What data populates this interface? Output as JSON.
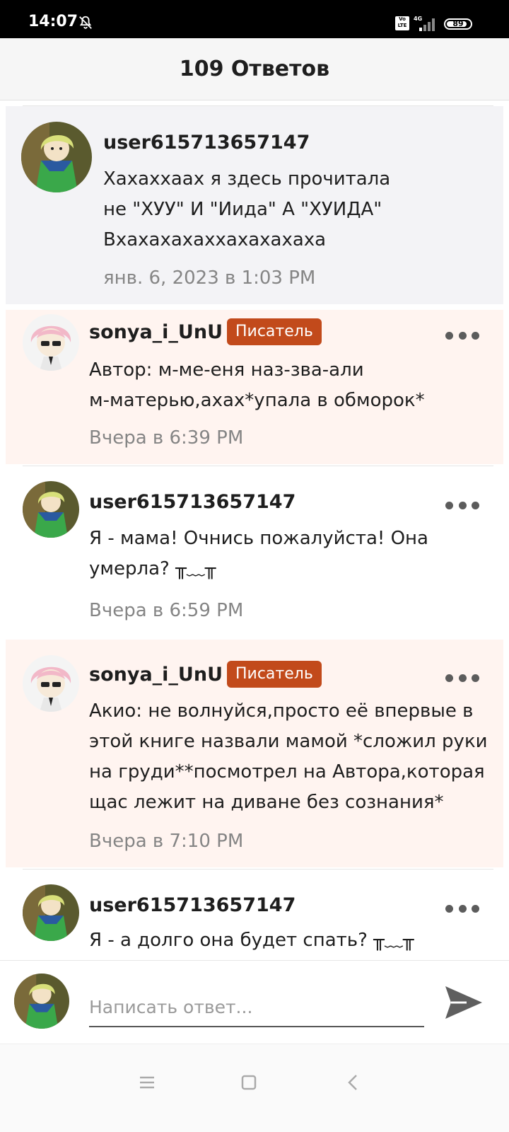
{
  "status_bar": {
    "time": "14:07",
    "volte_label": "Vo LTE",
    "network": "4G",
    "battery": "89",
    "battery_level": 0.89,
    "icons": [
      "mute-icon",
      "volte-icon",
      "signal-icon",
      "battery-icon"
    ]
  },
  "header": {
    "title": "109 Ответов"
  },
  "comments": [
    {
      "username": "user615713657147",
      "text": "Хахаххаах я здесь прочитала\nне \"ХУУ\" И \"Иида\" А \"ХУИДА\"\nВхахахахаххахахахаха",
      "timestamp": "янв. 6, 2023 в 1:03 PM"
    },
    {
      "username": "sonya_i_UnU",
      "badge": "Писатель",
      "text": "Автор: м-ме-еня наз-зва-али\nм-матерью,ахах*упала в обморок*",
      "timestamp": "Вчера в 6:39 PM"
    },
    {
      "username": "user615713657147",
      "text": "Я - мама! Очнись пожалуйста! Она\nумерла? ╥﹏╥",
      "timestamp": "Вчера в 6:59 PM"
    },
    {
      "username": "sonya_i_UnU",
      "badge": "Писатель",
      "text": "Акио: не волнуйся,просто её впервые в\nэтой книге назвали мамой *сложил руки\nна груди**посмотрел на Автора,которая\nщас лежит на диване без сознания*",
      "timestamp": "Вчера в 7:10 PM"
    },
    {
      "username": "user615713657147",
      "text": "Я - а долго она будет спать? ╥﹏╥",
      "timestamp": ""
    }
  ],
  "reply_bar": {
    "placeholder": "Написать ответ...",
    "send_icon": "send-icon"
  },
  "nav_bar": {
    "icons": [
      "menu-icon",
      "home-square-icon",
      "back-icon"
    ]
  },
  "colors": {
    "badge": "#c24a1b",
    "author_bg": "#fff4f0",
    "original_bg": "#f3f3f6",
    "timestamp": "#858585"
  }
}
